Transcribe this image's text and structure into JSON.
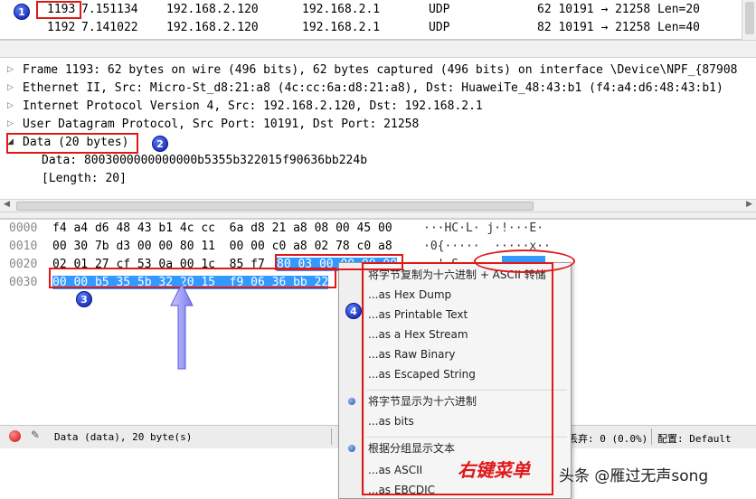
{
  "packet_list": {
    "rows": [
      {
        "no": "1193",
        "time": "7.151134",
        "source": "192.168.2.120",
        "destination": "192.168.2.1",
        "protocol": "UDP",
        "info": "62 10191 → 21258 Len=20"
      },
      {
        "no": "1192",
        "time": "7.141022",
        "source": "192.168.2.120",
        "destination": "192.168.2.1",
        "protocol": "UDP",
        "info": "82 10191 → 21258 Len=40"
      }
    ]
  },
  "details": {
    "frame": "Frame 1193: 62 bytes on wire (496 bits), 62 bytes captured (496 bits) on interface \\Device\\NPF_{87908",
    "ethernet": "Ethernet II, Src: Micro-St_d8:21:a8 (4c:cc:6a:d8:21:a8), Dst: HuaweiTe_48:43:b1 (f4:a4:d6:48:43:b1)",
    "ip": "Internet Protocol Version 4, Src: 192.168.2.120, Dst: 192.168.2.1",
    "udp": "User Datagram Protocol, Src Port: 10191, Dst Port: 21258",
    "data_header": "Data (20 bytes)",
    "data_value": "Data: 8003000000000000b5355b322015f90636bb224b",
    "data_length": "[Length: 20]"
  },
  "bytes": {
    "offsets": [
      "0000",
      "0010",
      "0020",
      "0030"
    ],
    "row0_hex": "f4 a4 d6 48 43 b1 4c cc  6a d8 21 a8 08 00 45 00",
    "row1_hex": "00 30 7b d3 00 00 80 11  00 00 c0 a8 02 78 c0 a8",
    "row2_hex_a": "02 01 27 cf 53 0a 00 1c  85 f7",
    "row2_hex_b": "80 03 00 00 00 00",
    "row3_hex": "00 00 b5 35 5b 32 20 15  f9 06 36 bb 22",
    "row0_ascii": "···HC·L· j·!···E·",
    "row1_ascii": "·0{·····  ·····x··",
    "row2_ascii": "··'·S··· ··"
  },
  "status": {
    "info": "Data (data), 20 byte(s)",
    "dropped": "丢弃: 0 (0.0%)",
    "profile": "配置: Default"
  },
  "context_menu": {
    "copy_header": "将字节复制为十六进制 + ASCII 转储",
    "items": [
      "...as Hex Dump",
      "...as Printable Text",
      "...as a Hex Stream",
      "...as Raw Binary",
      "...as Escaped String"
    ],
    "show_hex": "将字节显示为十六进制",
    "as_bits": "...as bits",
    "show_text": "根据分组显示文本",
    "as_ascii": "...as ASCII",
    "as_ebcdic": "...as EBCDIC"
  },
  "annotations": {
    "badge1": "1",
    "badge2": "2",
    "badge3": "3",
    "badge4": "4",
    "right_menu_label": "右键菜单",
    "watermark": "头条 @雁过无声song"
  },
  "colors": {
    "selection": "#3399ff",
    "annotation_red": "#e01818",
    "badge_blue": "#0a1fa0"
  }
}
